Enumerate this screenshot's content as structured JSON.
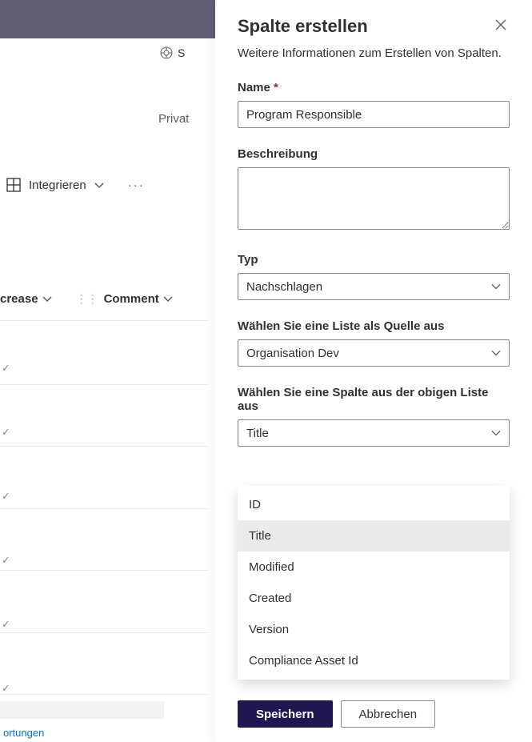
{
  "background": {
    "toolbar_letter": "S",
    "privat_label": "Privat",
    "integrate_label": "Integrieren",
    "columns": {
      "crease": "crease",
      "comment": "Comment"
    },
    "bottom_link": "ortungen"
  },
  "panel": {
    "title": "Spalte erstellen",
    "subtitle": "Weitere Informationen zum Erstellen von Spalten.",
    "fields": {
      "name": {
        "label": "Name",
        "value": "Program Responsible"
      },
      "description": {
        "label": "Beschreibung",
        "value": ""
      },
      "type": {
        "label": "Typ",
        "value": "Nachschlagen"
      },
      "source_list": {
        "label": "Wählen Sie eine Liste als Quelle aus",
        "value": "Organisation Dev"
      },
      "source_column": {
        "label": "Wählen Sie eine Spalte aus der obigen Liste aus",
        "value": "Title",
        "options": [
          "ID",
          "Title",
          "Modified",
          "Created",
          "Version",
          "Compliance Asset Id"
        ]
      }
    },
    "buttons": {
      "save": "Speichern",
      "cancel": "Abbrechen"
    }
  }
}
